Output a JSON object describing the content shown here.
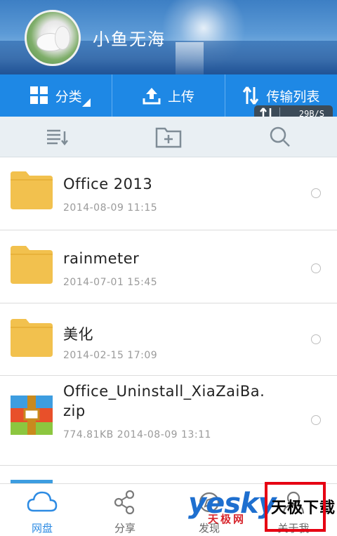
{
  "header": {
    "username": "小鱼无海"
  },
  "tabs": [
    {
      "label": "分类",
      "icon": "grid-icon"
    },
    {
      "label": "上传",
      "icon": "upload-icon"
    },
    {
      "label": "传输列表",
      "icon": "transfer-icon"
    }
  ],
  "transfer_speed": "29B/S",
  "toolbar": {
    "icons": [
      "sort-list-icon",
      "new-folder-icon",
      "search-icon"
    ]
  },
  "files": [
    {
      "name": "Office 2013",
      "meta": "2014-08-09  11:15",
      "type": "folder"
    },
    {
      "name": "rainmeter",
      "meta": "2014-07-01  15:45",
      "type": "folder"
    },
    {
      "name": "美化",
      "meta": "2014-02-15  17:09",
      "type": "folder"
    },
    {
      "name": "Office_Uninstall_XiaZaiBa.zip",
      "name_line1": "Office_Uninstall_XiaZaiBa.",
      "name_line2": "zip",
      "meta": "774.81KB  2014-08-09  13:11",
      "type": "zip"
    }
  ],
  "bottom_nav": [
    {
      "label": "网盘",
      "icon": "cloud-icon",
      "active": true
    },
    {
      "label": "分享",
      "icon": "share-icon",
      "active": false
    },
    {
      "label": "发现",
      "icon": "discover-icon",
      "active": false
    },
    {
      "label": "关于我",
      "icon": "person-icon",
      "active": false
    }
  ],
  "watermark": {
    "brand": "yesky",
    "sub": "天极网",
    "text": "天极下载"
  },
  "colors": {
    "accent": "#1e88e5",
    "folder": "#f2c14e",
    "highlight": "#e60012"
  }
}
